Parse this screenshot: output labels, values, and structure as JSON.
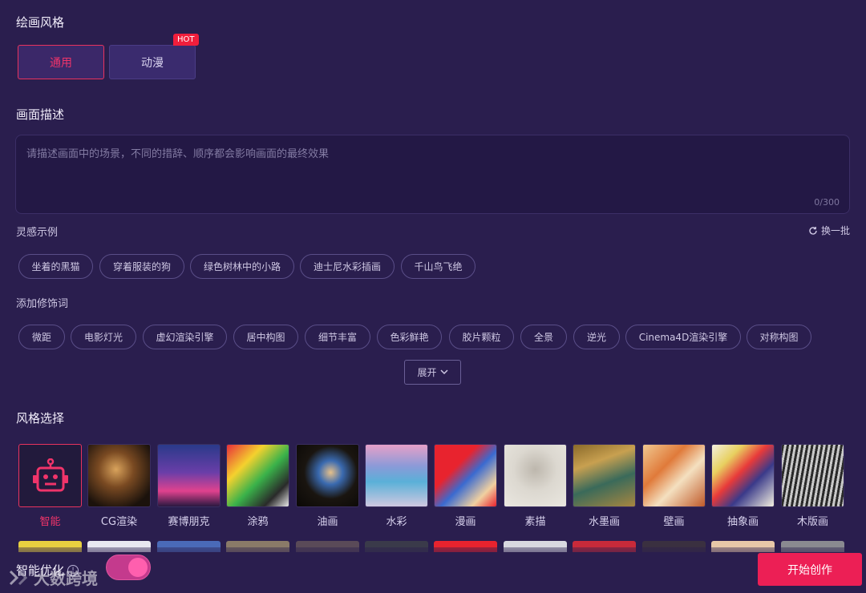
{
  "style_section": {
    "title": "绘画风格",
    "tabs": [
      {
        "label": "通用",
        "active": true
      },
      {
        "label": "动漫",
        "active": false
      }
    ],
    "hot_badge": "HOT"
  },
  "description": {
    "title": "画面描述",
    "placeholder": "请描述画面中的场景，不同的措辞、顺序都会影响画面的最终效果",
    "counter": "0/300"
  },
  "inspiration": {
    "title": "灵感示例",
    "refresh_label": "换一批",
    "chips": [
      "坐着的黑猫",
      "穿着服装的狗",
      "绿色树林中的小路",
      "迪士尼水彩插画",
      "千山鸟飞绝"
    ]
  },
  "modifiers": {
    "title": "添加修饰词",
    "chips": [
      "微距",
      "电影灯光",
      "虚幻渲染引擎",
      "居中构图",
      "细节丰富",
      "色彩鲜艳",
      "胶片颗粒",
      "全景",
      "逆光",
      "Cinema4D渲染引擎",
      "对称构图"
    ],
    "expand_label": "展开"
  },
  "style_select": {
    "title": "风格选择",
    "items": [
      {
        "label": "智能",
        "active": true
      },
      {
        "label": "CG渲染"
      },
      {
        "label": "赛博朋克"
      },
      {
        "label": "涂鸦"
      },
      {
        "label": "油画"
      },
      {
        "label": "水彩"
      },
      {
        "label": "漫画"
      },
      {
        "label": "素描"
      },
      {
        "label": "水墨画"
      },
      {
        "label": "壁画"
      },
      {
        "label": "抽象画"
      },
      {
        "label": "木版画"
      }
    ]
  },
  "bottom": {
    "optimize_label": "智能优化",
    "start_label": "开始创作",
    "watermark": "大数跨境"
  },
  "colors": {
    "background": "#2a1e4e",
    "accent": "#ec1f55",
    "active_text": "#f0346a"
  }
}
